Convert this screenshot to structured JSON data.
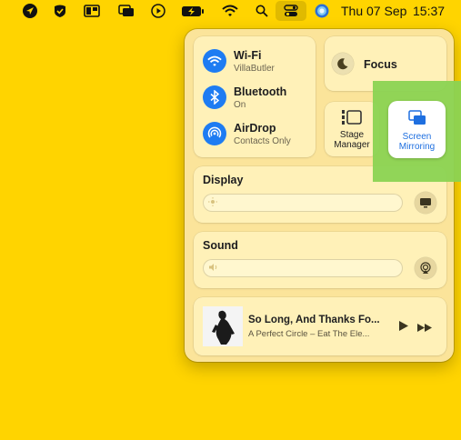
{
  "menubar": {
    "date": "Thu 07 Sep",
    "time": "15:37",
    "icons": [
      "location-icon",
      "check-icon",
      "window-layout-icon",
      "screen-mirror-icon",
      "play-icon",
      "battery-charging-icon",
      "wifi-icon",
      "search-icon",
      "control-center-icon",
      "siri-icon"
    ]
  },
  "network": {
    "wifi": {
      "title": "Wi-Fi",
      "subtitle": "VillaButler"
    },
    "bluetooth": {
      "title": "Bluetooth",
      "subtitle": "On"
    },
    "airdrop": {
      "title": "AirDrop",
      "subtitle": "Contacts Only"
    }
  },
  "focus": {
    "label": "Focus"
  },
  "stage_manager": {
    "line1": "Stage",
    "line2": "Manager"
  },
  "screen_mirroring": {
    "line1": "Screen",
    "line2": "Mirroring"
  },
  "display": {
    "title": "Display"
  },
  "sound": {
    "title": "Sound"
  },
  "now_playing": {
    "title": "So Long, And Thanks Fo...",
    "subtitle": "A Perfect Circle – Eat The Ele..."
  },
  "colors": {
    "accent": "#1e7cf2",
    "highlight": "#8bd352",
    "background": "#ffd400"
  }
}
